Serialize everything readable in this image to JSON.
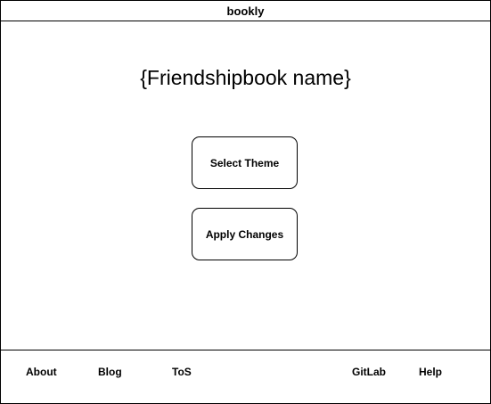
{
  "window": {
    "title": "bookly"
  },
  "main": {
    "page_title": "{Friendshipbook name}",
    "select_theme_label": "Select Theme",
    "apply_changes_label": "Apply Changes"
  },
  "footer": {
    "links": [
      {
        "label": "About"
      },
      {
        "label": "Blog"
      },
      {
        "label": "ToS"
      },
      {
        "label": "GitLab"
      },
      {
        "label": "Help"
      }
    ]
  }
}
